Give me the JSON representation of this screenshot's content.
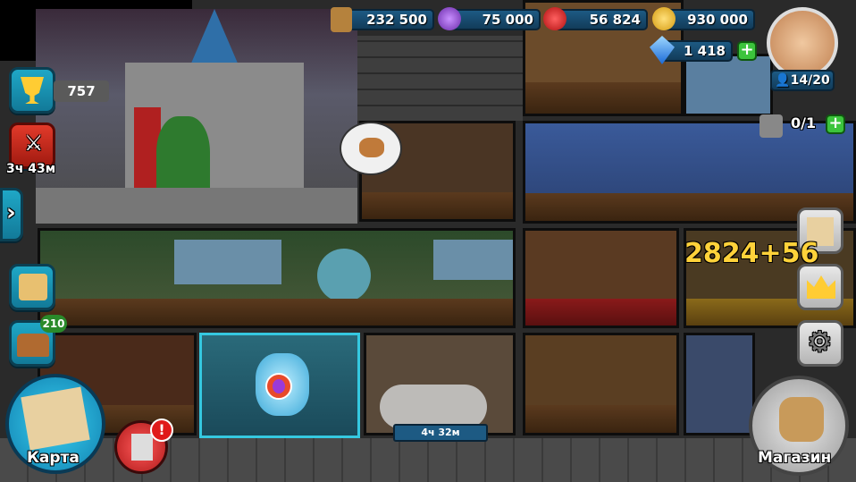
{
  "resources": {
    "wood": "232 500",
    "magic": "75 000",
    "food": "56 824",
    "gold": "930 000",
    "gems": "1 418"
  },
  "population": "14/20",
  "builders": "0/1",
  "trophies": "757",
  "battle_timer": "3ч 43м",
  "chest_count": "210",
  "room_timer": "4ч 32м",
  "floating_gold": "2824+56",
  "map_label": "Карта",
  "shop_label": "Магазин",
  "alert_symbol": "!",
  "expand_symbol": "›",
  "plus_symbol": "+"
}
